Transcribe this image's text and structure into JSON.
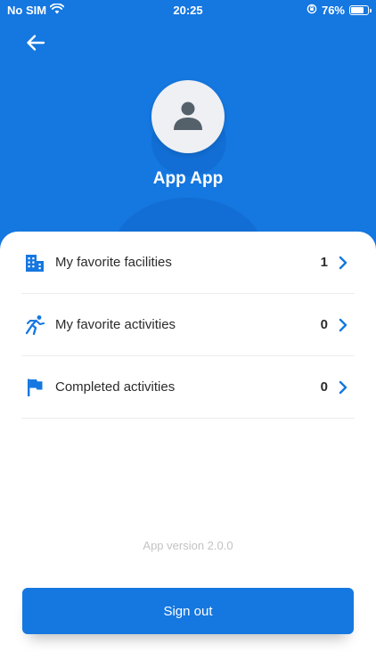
{
  "status_bar": {
    "carrier": "No SIM",
    "time": "20:25",
    "battery_percent": "76%",
    "battery_level": 0.76
  },
  "header": {
    "back_icon": "arrow-left-icon",
    "avatar_icon": "user-icon",
    "user_name": "App App",
    "background_color": "#1577e0"
  },
  "menu": {
    "items": [
      {
        "icon": "buildings-icon",
        "label": "My favorite facilities",
        "count": "1"
      },
      {
        "icon": "running-person-icon",
        "label": "My favorite activities",
        "count": "0"
      },
      {
        "icon": "flag-icon",
        "label": "Completed activities",
        "count": "0"
      }
    ]
  },
  "footer": {
    "app_version": "App version 2.0.0",
    "sign_out_label": "Sign out"
  }
}
